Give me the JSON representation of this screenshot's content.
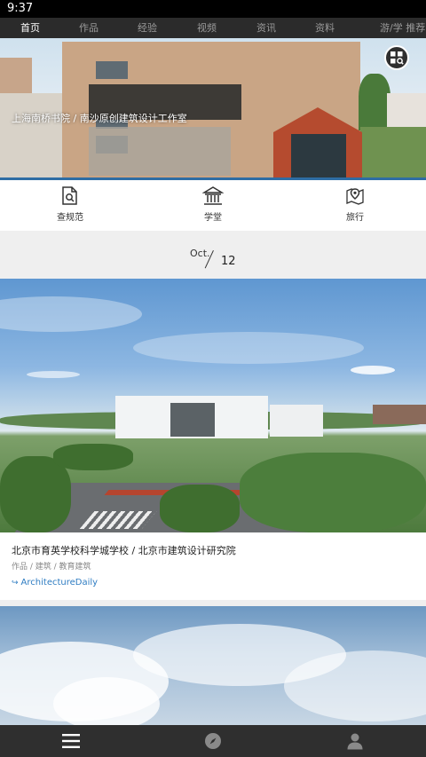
{
  "status": {
    "time": "9:37"
  },
  "nav": {
    "items": [
      "首页",
      "作品",
      "经验",
      "视频",
      "资讯",
      "资料"
    ],
    "right": "游/学 推荐"
  },
  "hero": {
    "caption": "上海南桥书院 / 南沙原创建筑设计工作室"
  },
  "quick_links": [
    {
      "label": "查规范",
      "icon": "document-search-icon"
    },
    {
      "label": "学堂",
      "icon": "classical-building-icon"
    },
    {
      "label": "旅行",
      "icon": "map-pin-icon"
    }
  ],
  "date": {
    "month": "Oct.",
    "day": "12"
  },
  "articles": [
    {
      "title": "北京市育英学校科学城学校 / 北京市建筑设计研究院",
      "tags": "作品 / 建筑 / 教育建筑",
      "source": "ArchitectureDaily"
    }
  ],
  "bottom_tabs": [
    {
      "icon": "menu-icon"
    },
    {
      "icon": "compass-icon"
    },
    {
      "icon": "user-icon"
    }
  ],
  "colors": {
    "accent": "#2e6da4",
    "link": "#2e7cc2",
    "nav_bg": "#2b2b2b"
  }
}
